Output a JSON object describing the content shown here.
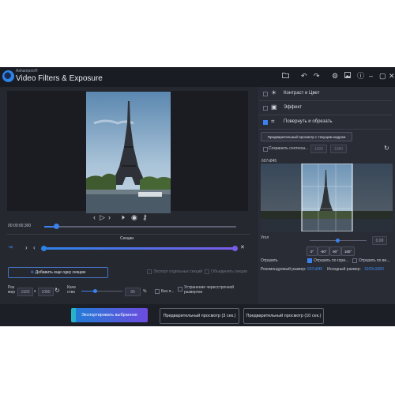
{
  "app": {
    "brand": "Ashampoo®",
    "title": "Video Filters & Exposure"
  },
  "titlebar_icons": [
    "folder-icon",
    "undo-icon",
    "redo-icon",
    "gear-icon",
    "image-icon",
    "info-icon",
    "minimize-icon",
    "maximize-icon",
    "close-icon"
  ],
  "player": {
    "time": "00:00:00,300",
    "progress_fraction": 0.06,
    "controls": [
      "prev-frame-icon",
      "play-icon",
      "next-frame-icon",
      "volume-icon",
      "eye-icon",
      "key-icon"
    ]
  },
  "sections": {
    "title": "Секции",
    "add_button": "Добавить еще одну секцию",
    "export_separate": "Экспорт отдельных секций",
    "merge_sections": "Объединить секции",
    "add_icon": "plus-icon"
  },
  "bottom_controls": {
    "size_label": "Раз мер",
    "width": "1920",
    "times": "x",
    "height": "1080",
    "quality_label": "Каче ство",
    "quality_value": "90",
    "unit": "%",
    "lossless": "Без п...",
    "deinterlace": "Устранение чересстрочной развертки"
  },
  "right_panel": {
    "items": [
      {
        "label": "Контраст и Цвет",
        "checked": false
      },
      {
        "label": "Эффект",
        "checked": false
      },
      {
        "label": "Повернуть и обрезать",
        "checked": true
      }
    ],
    "preview_button": "Предварительный просмотр с текущим кадром",
    "save_ratio": "Сохранить соотнош...",
    "crop_w": "1920",
    "crop_h": "1080",
    "thumb_label": "607x845",
    "angle_label": "Угол",
    "angle_value": "0.00",
    "rot_buttons": [
      "0°",
      "-90°",
      "90°",
      "180°"
    ],
    "mirror_label": "Отразить",
    "mirror_h": "Отразить по гори...",
    "mirror_v": "Отразить по ве...",
    "recommended_label": "Рекомендуемый размер:",
    "recommended_value": "607x845",
    "source_label": "Исходный размер:",
    "source_value": "1920x1080"
  },
  "actions": {
    "export": "Экспортировать выбранное",
    "preview3": "Предварительный просмотр (3 сек.)",
    "preview10": "Предварительный просмотр (10 сек.)"
  },
  "colors": {
    "accent": "#3b82f0",
    "export_start": "#1e7fd6",
    "export_end": "#6d4be0"
  }
}
